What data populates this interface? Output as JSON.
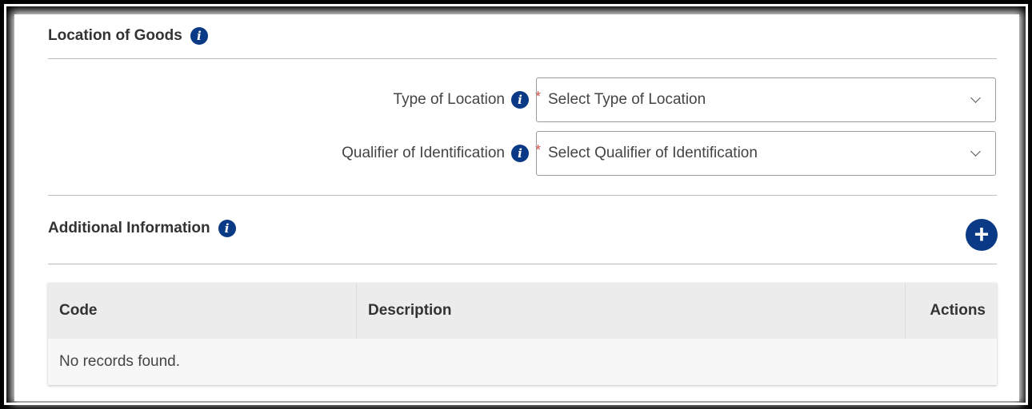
{
  "location_section": {
    "title": "Location of Goods",
    "fields": [
      {
        "label": "Type of Location",
        "required_mark": "*",
        "placeholder": "Select Type of Location"
      },
      {
        "label": "Qualifier of Identification",
        "required_mark": "*",
        "placeholder": "Select Qualifier of Identification"
      }
    ]
  },
  "additional_section": {
    "title": "Additional Information",
    "table": {
      "headers": [
        "Code",
        "Description",
        "Actions"
      ],
      "empty_message": "No records found."
    }
  },
  "icons": {
    "info": "info-circle-icon",
    "add": "plus-circle-icon",
    "dropdown": "chevron-down-icon"
  },
  "colors": {
    "accent": "#0a3a85",
    "required": "#d9534f"
  }
}
